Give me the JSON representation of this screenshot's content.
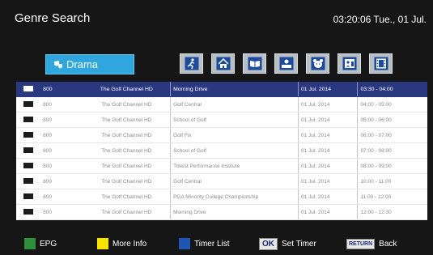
{
  "header": {
    "title": "Genre Search",
    "clock": "03:20:06 Tue., 01 Jul."
  },
  "genre": {
    "label": "Drama",
    "icon": "drama-icon"
  },
  "categories": [
    {
      "name": "sports-icon"
    },
    {
      "name": "house-icon"
    },
    {
      "name": "book-icon"
    },
    {
      "name": "news-presenter-icon"
    },
    {
      "name": "kids-bear-icon"
    },
    {
      "name": "documentary-icon"
    },
    {
      "name": "film-icon"
    }
  ],
  "rows": [
    {
      "ch": "800",
      "name": "The Golf Channel HD",
      "program": "Morning Drive",
      "date": "01 Jul. 2014",
      "time": "03:30 - 04:00",
      "selected": true
    },
    {
      "ch": "800",
      "name": "The Golf Channel HD",
      "program": "Golf Central",
      "date": "01 Jul. 2014",
      "time": "04:00 - 05:00"
    },
    {
      "ch": "800",
      "name": "The Golf Channel HD",
      "program": "School of Golf",
      "date": "01 Jul. 2014",
      "time": "05:00 - 06:00"
    },
    {
      "ch": "800",
      "name": "The Golf Channel HD",
      "program": "Golf Fix",
      "date": "01 Jul. 2014",
      "time": "06:00 - 07:00"
    },
    {
      "ch": "800",
      "name": "The Golf Channel HD",
      "program": "School of Golf",
      "date": "01 Jul. 2014",
      "time": "07:00 - 08:00"
    },
    {
      "ch": "800",
      "name": "The Golf Channel HD",
      "program": "Titleist Performance Institute",
      "date": "01 Jul. 2014",
      "time": "08:00 - 09:00"
    },
    {
      "ch": "800",
      "name": "The Golf Channel HD",
      "program": "Golf Central",
      "date": "01 Jul. 2014",
      "time": "10:00 - 11:00"
    },
    {
      "ch": "800",
      "name": "The Golf Channel HD",
      "program": "PGA Minority College Championship",
      "date": "01 Jul. 2014",
      "time": "11:00 - 12:00"
    },
    {
      "ch": "800",
      "name": "The Golf Channel HD",
      "program": "Morning Drive",
      "date": "01 Jul. 2014",
      "time": "12:00 - 12:30"
    }
  ],
  "footer": {
    "epg": {
      "label": "EPG",
      "color": "#2f8f3a"
    },
    "info": {
      "label": "More Info",
      "color": "#f4e400"
    },
    "timer_list": {
      "label": "Timer List",
      "color": "#1f56b6"
    },
    "set_timer": {
      "key": "OK",
      "label": "Set Timer"
    },
    "back": {
      "key": "RETURN",
      "label": "Back"
    }
  }
}
